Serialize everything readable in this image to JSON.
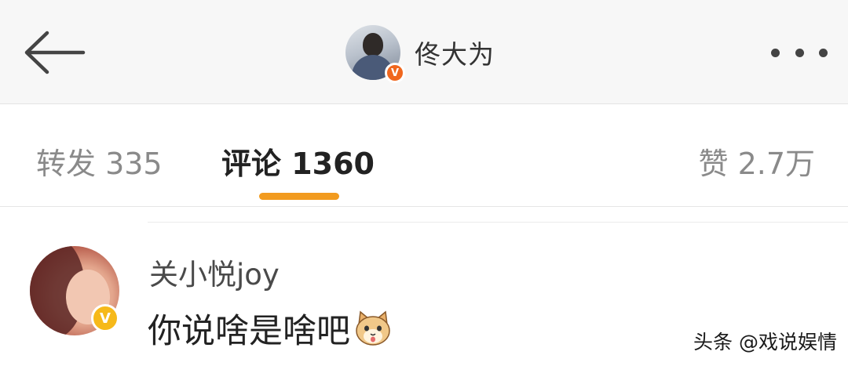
{
  "header": {
    "user_name": "佟大为",
    "avatar_icon": "user-avatar-photo",
    "verified_badge": "V",
    "more_icon": "more-horizontal-icon"
  },
  "tabs": [
    {
      "label": "转发 335",
      "active": false
    },
    {
      "label": "评论 1360",
      "active": true
    },
    {
      "label": "赞 2.7万",
      "active": false
    }
  ],
  "comment": {
    "user_name": "关小悦joy",
    "text": "你说啥是啥吧",
    "verified_badge": "V",
    "emoji": "cat-face-emoji"
  },
  "watermark": "头条 @戏说娱情",
  "colors": {
    "accent": "#f29b1f",
    "badge_orange": "#f0671e",
    "badge_yellow": "#f6b91a",
    "topbar_bg": "#f7f7f7"
  }
}
